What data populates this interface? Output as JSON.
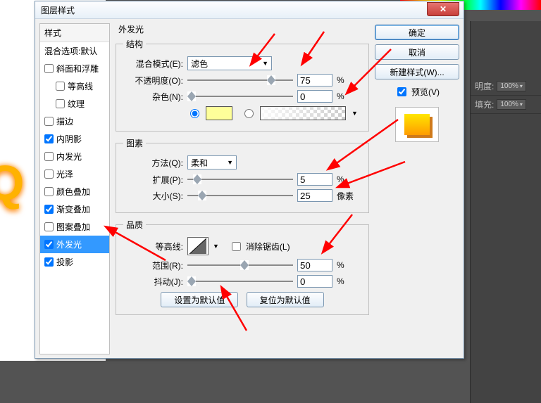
{
  "dialog_title": "图层样式",
  "sidebar": {
    "header": "样式",
    "blending": "混合选项:默认",
    "items": [
      {
        "label": "斜面和浮雕",
        "checked": false
      },
      {
        "label": "等高线",
        "checked": false,
        "indent": true
      },
      {
        "label": "纹理",
        "checked": false,
        "indent": true
      },
      {
        "label": "描边",
        "checked": false
      },
      {
        "label": "内阴影",
        "checked": true
      },
      {
        "label": "内发光",
        "checked": false
      },
      {
        "label": "光泽",
        "checked": false
      },
      {
        "label": "颜色叠加",
        "checked": false
      },
      {
        "label": "渐变叠加",
        "checked": true
      },
      {
        "label": "图案叠加",
        "checked": false
      },
      {
        "label": "外发光",
        "checked": true,
        "selected": true
      },
      {
        "label": "投影",
        "checked": true
      }
    ]
  },
  "panel_title": "外发光",
  "structure": {
    "legend": "结构",
    "blend_label": "混合模式(E):",
    "blend_value": "滤色",
    "opacity_label": "不透明度(O):",
    "opacity_value": "75",
    "opacity_unit": "%",
    "noise_label": "杂色(N):",
    "noise_value": "0",
    "noise_unit": "%"
  },
  "elements": {
    "legend": "图素",
    "technique_label": "方法(Q):",
    "technique_value": "柔和",
    "spread_label": "扩展(P):",
    "spread_value": "5",
    "spread_unit": "%",
    "size_label": "大小(S):",
    "size_value": "25",
    "size_unit": "像素"
  },
  "quality": {
    "legend": "品质",
    "contour_label": "等高线:",
    "antialias": "消除锯齿(L)",
    "range_label": "范围(R):",
    "range_value": "50",
    "range_unit": "%",
    "jitter_label": "抖动(J):",
    "jitter_value": "0",
    "jitter_unit": "%"
  },
  "bottom": {
    "set_default": "设置为默认值",
    "reset_default": "复位为默认值"
  },
  "buttons": {
    "ok": "确定",
    "cancel": "取消",
    "new_style": "新建样式(W)...",
    "preview": "预览(V)"
  },
  "right_panel": {
    "opacity_label": "明度:",
    "opacity_value": "100%",
    "fill_label": "填充:",
    "fill_value": "100%"
  },
  "chart_data": {
    "type": "table",
    "title": "Outer Glow layer-style parameters",
    "series": [
      {
        "name": "不透明度",
        "value": 75,
        "unit": "%"
      },
      {
        "name": "杂色",
        "value": 0,
        "unit": "%"
      },
      {
        "name": "扩展",
        "value": 5,
        "unit": "%"
      },
      {
        "name": "大小",
        "value": 25,
        "unit": "像素"
      },
      {
        "name": "范围",
        "value": 50,
        "unit": "%"
      },
      {
        "name": "抖动",
        "value": 0,
        "unit": "%"
      }
    ]
  }
}
